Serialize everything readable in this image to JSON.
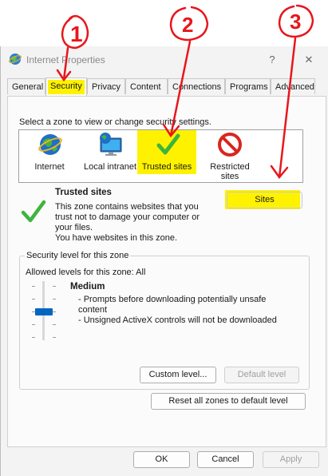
{
  "window": {
    "title": "Internet Properties",
    "help_label": "?",
    "close_label": "✕"
  },
  "tabs": [
    "General",
    "Security",
    "Privacy",
    "Content",
    "Connections",
    "Programs",
    "Advanced"
  ],
  "security": {
    "zone_prompt": "Select a zone to view or change security settings.",
    "zones": [
      {
        "label": "Internet",
        "icon": "globe-icon"
      },
      {
        "label": "Local intranet",
        "icon": "monitor-globe-icon"
      },
      {
        "label": "Trusted sites",
        "icon": "green-check-icon"
      },
      {
        "label_line1": "Restricted",
        "label_line2": "sites",
        "icon": "restricted-icon"
      }
    ],
    "selected_zone": {
      "name": "Trusted sites",
      "desc1": "This zone contains websites that you",
      "desc2": "trust not to damage your computer or",
      "desc3": "your files.",
      "desc4": "You have websites in this zone."
    },
    "sites_button": "Sites",
    "level_group_title": "Security level for this zone",
    "allowed_levels": "Allowed levels for this zone: All",
    "level_name": "Medium",
    "level_desc1": "- Prompts before downloading potentially unsafe",
    "level_desc2": "content",
    "level_desc3": "- Unsigned ActiveX controls will not be downloaded",
    "custom_level_button": "Custom level...",
    "default_level_button": "Default level",
    "reset_all_button": "Reset all zones to default level"
  },
  "footer": {
    "ok": "OK",
    "cancel": "Cancel",
    "apply": "Apply"
  },
  "annotations": {
    "one": "1",
    "two": "2",
    "three": "3"
  },
  "colors": {
    "highlight": "#fff200",
    "annotation_red": "#e8161b",
    "check_green": "#3db53d"
  }
}
